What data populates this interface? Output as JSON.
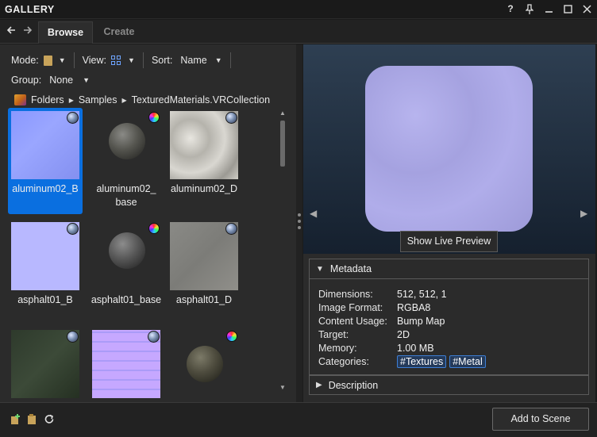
{
  "window": {
    "title": "GALLERY",
    "controls": [
      "?",
      "pin",
      "minimize",
      "maximize",
      "close"
    ]
  },
  "tabs": [
    {
      "label": "Browse",
      "active": true
    },
    {
      "label": "Create",
      "active": false
    }
  ],
  "toolbar": {
    "mode_label": "Mode:",
    "view_label": "View:",
    "sort_label": "Sort:",
    "sort_value": "Name",
    "group_label": "Group:",
    "group_value": "None"
  },
  "breadcrumb": [
    "Folders",
    "Samples",
    "TexturedMaterials.VRCollection"
  ],
  "items": [
    {
      "label": "aluminum02_B",
      "badge": "globe-icon",
      "selected": true
    },
    {
      "label": "aluminum02_\nbase",
      "badge": "color-wheel-icon",
      "selected": false
    },
    {
      "label": "aluminum02_D",
      "badge": "globe-icon",
      "selected": false
    },
    {
      "label": "asphalt01_B",
      "badge": "globe-icon",
      "selected": false
    },
    {
      "label": "asphalt01_base",
      "badge": "color-wheel-icon",
      "selected": false
    },
    {
      "label": "asphalt01_D",
      "badge": "globe-icon",
      "selected": false
    },
    {
      "label": "",
      "badge": "globe-icon",
      "selected": false
    },
    {
      "label": "",
      "badge": "globe-icon",
      "selected": false
    },
    {
      "label": "",
      "badge": "color-wheel-icon",
      "selected": false
    }
  ],
  "preview": {
    "live_preview_button": "Show Live Preview"
  },
  "metadata": {
    "header": "Metadata",
    "rows": [
      {
        "key": "Dimensions:",
        "value": "512, 512, 1"
      },
      {
        "key": "Image Format:",
        "value": "RGBA8"
      },
      {
        "key": "Content Usage:",
        "value": "Bump Map"
      },
      {
        "key": "Target:",
        "value": "2D"
      },
      {
        "key": "Memory:",
        "value": "1.00 MB"
      }
    ],
    "categories_label": "Categories:",
    "categories": [
      "#Textures",
      "#Metal"
    ],
    "description_header": "Description"
  },
  "footer": {
    "add_button": "Add to Scene"
  },
  "colors": {
    "accent": "#0a6fe0",
    "panel": "#2b2b2b",
    "chip_border": "#3d7fd6"
  }
}
